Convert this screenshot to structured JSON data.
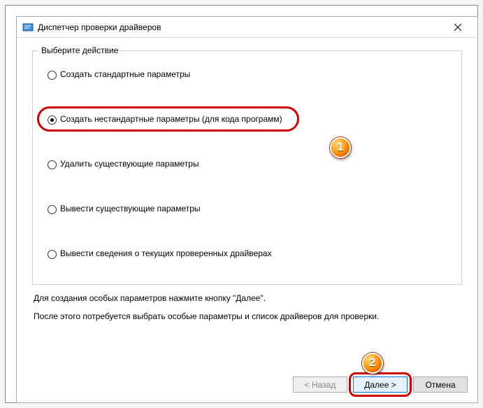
{
  "window": {
    "title": "Диспетчер проверки драйверов"
  },
  "groupbox": {
    "legend": "Выберите действие"
  },
  "options": {
    "opt1": "Создать стандартные параметры",
    "opt2": "Создать нестандартные параметры (для кода программ)",
    "opt3": "Удалить существующие параметры",
    "opt4": "Вывести существующие параметры",
    "opt5": "Вывести сведения о текущих проверенных драйверах"
  },
  "description": {
    "line1": "Для создания особых параметров нажмите кнопку \"Далее\".",
    "line2": "После этого потребуется выбрать особые параметры и список драйверов для проверки."
  },
  "buttons": {
    "back": "< Назад",
    "next": "Далее >",
    "cancel": "Отмена"
  },
  "badges": {
    "b1": "1",
    "b2": "2"
  }
}
